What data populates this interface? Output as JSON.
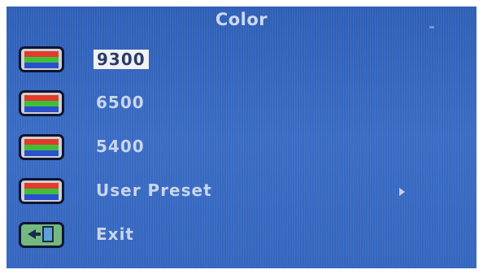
{
  "title": "Color",
  "menu": {
    "items": [
      {
        "label": "9300",
        "icon": "color-bars-icon",
        "selected": true
      },
      {
        "label": "6500",
        "icon": "color-bars-icon"
      },
      {
        "label": "5400",
        "icon": "color-bars-icon"
      },
      {
        "label": "User Preset",
        "icon": "color-bars-icon",
        "has_submenu": true,
        "submenu_indicator": "arrow-right-icon"
      },
      {
        "label": "Exit",
        "icon": "exit-door-icon"
      }
    ]
  },
  "colors": {
    "background": "#3566bf",
    "text": "#c9d5ea",
    "selected_bg": "#f2f2f2",
    "selected_text": "#2a3d6a"
  }
}
